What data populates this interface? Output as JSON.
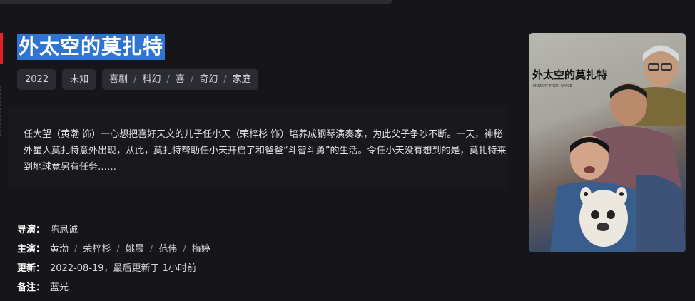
{
  "title": "外太空的莫扎特",
  "tags": {
    "year": "2022",
    "region": "未知",
    "genres": [
      "喜剧",
      "科幻",
      "喜",
      "奇幻",
      "家庭"
    ]
  },
  "synopsis": "任大望（黄渤 饰）一心想把喜好天文的儿子任小天（荣梓杉 饰）培养成钢琴演奏家，为此父子争吵不断。一天，神秘外星人莫扎特意外出现，从此，莫扎特帮助任小天开启了和爸爸“斗智斗勇”的生活。令任小天没有想到的是，莫扎特来到地球竟另有任务……",
  "info": {
    "director_label": "导演：",
    "director": "陈思诚",
    "cast_label": "主演：",
    "cast": [
      "黄渤",
      "荣梓杉",
      "姚晨",
      "范伟",
      "梅婷"
    ],
    "update_label": "更新：",
    "update": "2022-08-19，最后更新于 1小时前",
    "note_label": "备注：",
    "note": "蓝光"
  },
  "poster": {
    "title_text": "外太空的莫扎特",
    "subtitle_text": "MOZART FROM SPACE"
  },
  "colors": {
    "accent": "#e02424",
    "title_highlight": "#2f74d0",
    "background": "#16161a",
    "tag_bg": "#2b2c33"
  }
}
